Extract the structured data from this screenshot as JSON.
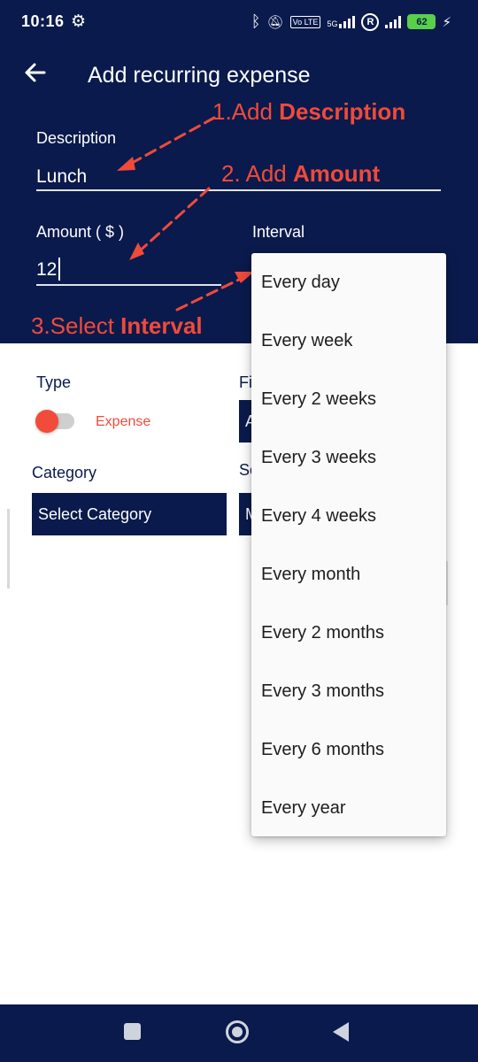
{
  "status_bar": {
    "time": "10:16",
    "icons": [
      "gear-icon",
      "bluetooth-icon",
      "mute-icon",
      "volte-icon",
      "5g-signal-icon",
      "registered-icon",
      "signal-icon",
      "battery-icon",
      "charging-icon"
    ],
    "network": "5G",
    "volte": "Vo LTE",
    "registered": "R",
    "battery": "62"
  },
  "header": {
    "title": "Add recurring expense",
    "back_icon": "arrow-left-icon",
    "background": "#0a1a4c"
  },
  "form": {
    "description_label": "Description",
    "description_value": "Lunch",
    "amount_label": "Amount ( $ )",
    "amount_value": "12",
    "interval_label": "Interval",
    "type_label": "Type",
    "type_value": "Expense",
    "category_label": "Category",
    "category_value": "Select Category",
    "fi_label_partial": "Fi",
    "se_label_partial": "Se",
    "fi_box_partial": "A",
    "se_box_partial": "M"
  },
  "annotations": {
    "step1_prefix": "1.Add ",
    "step1_bold": "Description",
    "step2_prefix": "2. Add ",
    "step2_bold": "Amount",
    "step3_prefix": "3.Select ",
    "step3_bold": "Interval",
    "color": "#f04a3a"
  },
  "interval_dropdown": {
    "options": [
      "Every day",
      "Every week",
      "Every 2 weeks",
      "Every 3 weeks",
      "Every 4 weeks",
      "Every month",
      "Every 2 months",
      "Every 3 months",
      "Every 6 months",
      "Every year"
    ]
  },
  "nav_bar": {
    "icons": [
      "recents-square-icon",
      "home-circle-icon",
      "back-triangle-icon"
    ]
  },
  "colors": {
    "primary": "#0a1a4c",
    "accent": "#f04a3a",
    "toggle": "#f24b39"
  }
}
